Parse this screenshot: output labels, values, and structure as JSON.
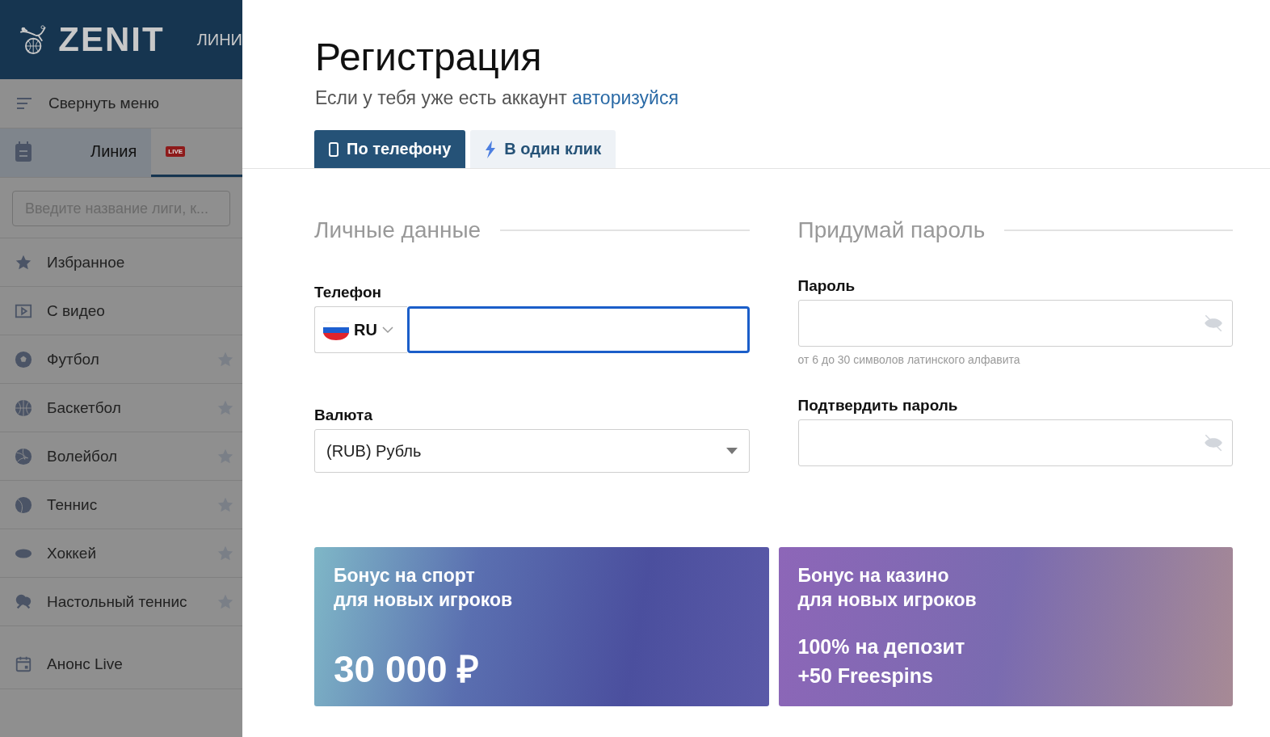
{
  "sidebar": {
    "brand": "ZENIT",
    "nav_peek": "ЛИНИ",
    "collapse": "Свернуть меню",
    "tabs": [
      {
        "kind": "line",
        "label": "Линия",
        "selected": true
      },
      {
        "kind": "live",
        "label": "LIVE",
        "selected": false
      }
    ],
    "search": {
      "placeholder": "Введите название лиги, к..."
    },
    "items": [
      {
        "label": "Избранное",
        "kind": "section"
      },
      {
        "label": "С видео",
        "kind": "section"
      },
      {
        "label": "Футбол",
        "kind": "sport"
      },
      {
        "label": "Баскетбол",
        "kind": "sport"
      },
      {
        "label": "Волейбол",
        "kind": "sport"
      },
      {
        "label": "Теннис",
        "kind": "sport"
      },
      {
        "label": "Хоккей",
        "kind": "sport"
      },
      {
        "label": "Настольный теннис",
        "kind": "sport"
      },
      {
        "label": "Анонс Live",
        "kind": "announce"
      }
    ]
  },
  "modal": {
    "title": "Регистрация",
    "subtitle": "Если у тебя уже есть аккаунт",
    "login_link": "авторизуйся",
    "tabs": [
      {
        "label": "По телефону",
        "kind": "phone",
        "selected": true
      },
      {
        "label": "В один клик",
        "kind": "oneclick",
        "selected": false
      }
    ],
    "personal": {
      "heading": "Личные данные",
      "phone_label": "Телефон",
      "country": "RU",
      "currency_label": "Валюта",
      "currency": "(RUB) Рубль"
    },
    "password": {
      "heading": "Придумай пароль",
      "password_label": "Пароль",
      "hint": "от 6 до 30 символов латинского алфавита",
      "confirm_label": "Подтвердить пароль"
    },
    "banners": [
      {
        "kind": "sport",
        "title": [
          "Бонус на спорт",
          "для новых игроков"
        ],
        "offer": [
          "30 000 ₽"
        ]
      },
      {
        "kind": "casino",
        "title": [
          "Бонус на казино",
          "для новых игроков"
        ],
        "offer": [
          "100% на депозит",
          "+50 Freespins"
        ]
      }
    ]
  }
}
